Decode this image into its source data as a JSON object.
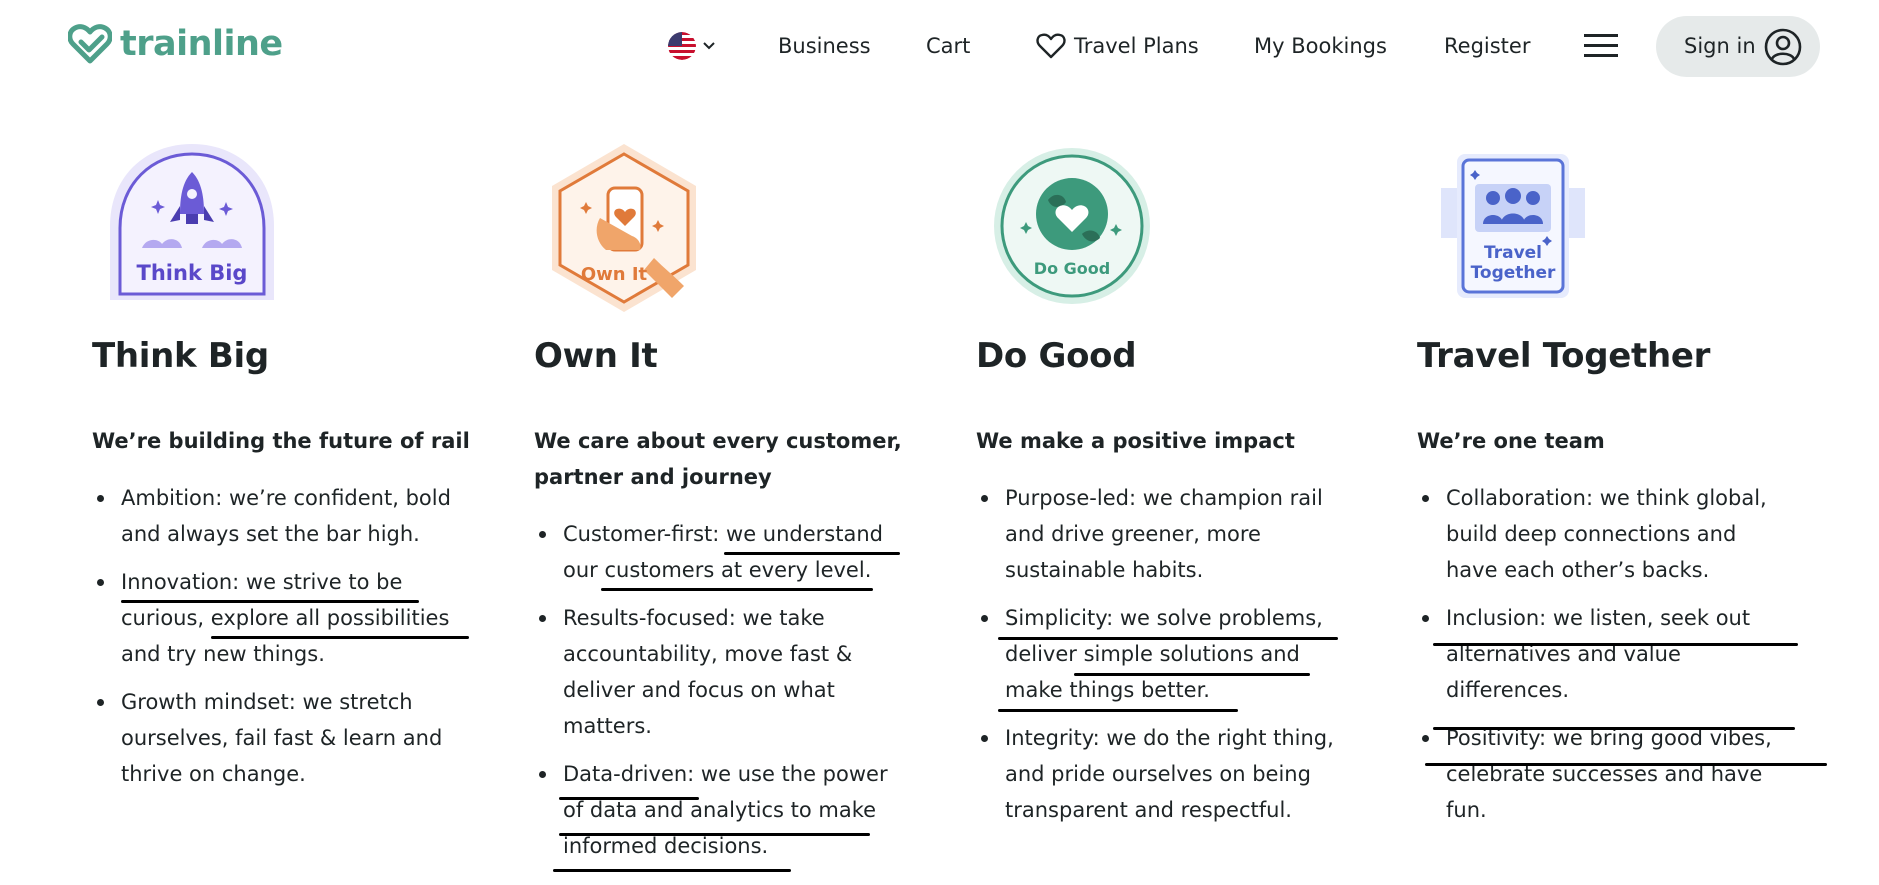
{
  "brand": {
    "name": "trainline",
    "color": "#4ea08a"
  },
  "nav": {
    "country_icon": "us-flag-icon",
    "business": "Business",
    "cart": "Cart",
    "travel_plans": "Travel Plans",
    "my_bookings": "My Bookings",
    "register": "Register",
    "sign_in": "Sign in"
  },
  "values": [
    {
      "badge_label": "Think Big",
      "title": "Think Big",
      "subtitle": "We’re building the future of rail",
      "bullets": [
        "Ambition: we’re confident, bold and always set the bar high.",
        "Innovation: we strive to be curious, explore all possibilities and try new things.",
        "Growth mindset: we stretch ourselves, fail fast & learn and thrive on change."
      ]
    },
    {
      "badge_label": "Own It",
      "title": "Own It",
      "subtitle": "We care about every customer, partner and journey",
      "bullets": [
        "Customer-first: we understand our customers at every level.",
        "Results-focused: we take accountability, move fast & deliver and focus on what matters.",
        "Data-driven: we use the power of data and analytics to make informed decisions."
      ]
    },
    {
      "badge_label": "Do Good",
      "title": "Do Good",
      "subtitle": "We make a positive impact",
      "bullets": [
        "Purpose-led: we champion rail and drive greener, more sustainable habits.",
        "Simplicity: we solve problems, deliver simple solutions and make things better.",
        "Integrity: we do the right thing, and pride ourselves on being transparent and respectful."
      ]
    },
    {
      "badge_label_line1": "Travel",
      "badge_label_line2": "Together",
      "title": "Travel Together",
      "subtitle": "We’re one team",
      "bullets": [
        "Collaboration: we think global, build deep connections and have each other’s backs.",
        "Inclusion: we listen, seek out alternatives and value differences.",
        "Positivity: we bring good vibes, celebrate successes and have fun."
      ]
    }
  ]
}
